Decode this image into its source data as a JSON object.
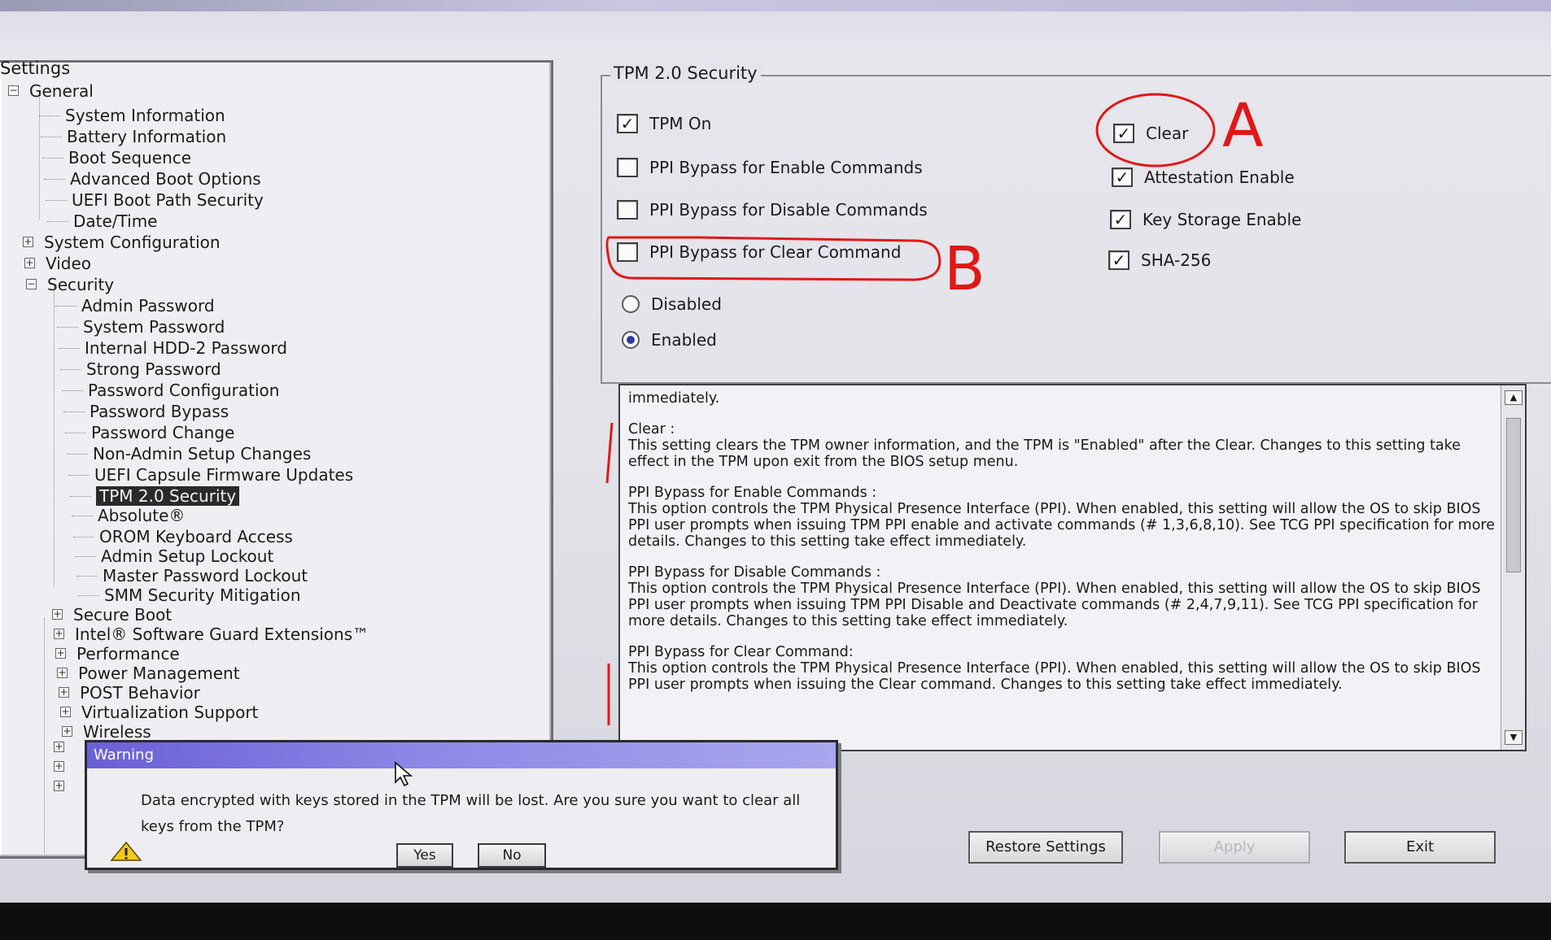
{
  "tree": {
    "title": "Settings",
    "items": [
      {
        "label": "General",
        "expander": "−"
      },
      {
        "label": "System Information"
      },
      {
        "label": "Battery Information"
      },
      {
        "label": "Boot Sequence"
      },
      {
        "label": "Advanced Boot Options"
      },
      {
        "label": "UEFI Boot Path Security"
      },
      {
        "label": "Date/Time"
      },
      {
        "label": "System Configuration",
        "expander": "+"
      },
      {
        "label": "Video",
        "expander": "+"
      },
      {
        "label": "Security",
        "expander": "−"
      },
      {
        "label": "Admin Password"
      },
      {
        "label": "System Password"
      },
      {
        "label": "Internal HDD-2 Password"
      },
      {
        "label": "Strong Password"
      },
      {
        "label": "Password Configuration"
      },
      {
        "label": "Password Bypass"
      },
      {
        "label": "Password Change"
      },
      {
        "label": "Non-Admin Setup Changes"
      },
      {
        "label": "UEFI Capsule Firmware Updates"
      },
      {
        "label": "TPM 2.0 Security",
        "selected": true
      },
      {
        "label": "Absolute®"
      },
      {
        "label": "OROM Keyboard Access"
      },
      {
        "label": "Admin Setup Lockout"
      },
      {
        "label": "Master Password Lockout"
      },
      {
        "label": "SMM Security Mitigation"
      },
      {
        "label": "Secure Boot",
        "expander": "+"
      },
      {
        "label": "Intel® Software Guard Extensions™",
        "expander": "+"
      },
      {
        "label": "Performance",
        "expander": "+"
      },
      {
        "label": "Power Management",
        "expander": "+"
      },
      {
        "label": "POST Behavior",
        "expander": "+"
      },
      {
        "label": "Virtualization Support",
        "expander": "+"
      },
      {
        "label": "Wireless",
        "expander": "+"
      }
    ]
  },
  "group": {
    "legend": "TPM 2.0 Security",
    "left_checks": [
      {
        "label": "TPM On",
        "checked": true
      },
      {
        "label": "PPI Bypass for Enable Commands",
        "checked": false
      },
      {
        "label": "PPI Bypass for Disable Commands",
        "checked": false
      },
      {
        "label": "PPI Bypass for Clear Command",
        "checked": false
      }
    ],
    "right_checks": [
      {
        "label": "Clear",
        "checked": true
      },
      {
        "label": "Attestation Enable",
        "checked": true
      },
      {
        "label": "Key Storage Enable",
        "checked": true
      },
      {
        "label": "SHA-256",
        "checked": true
      }
    ],
    "radios": [
      {
        "label": "Disabled",
        "selected": false
      },
      {
        "label": "Enabled",
        "selected": true
      }
    ],
    "check_mark": "☑"
  },
  "help": {
    "line0": "immediately.",
    "clear_title": "Clear :",
    "clear_text": "This setting clears the TPM owner information, and the TPM is \"Enabled\" after the Clear.  Changes to this setting take effect in the TPM upon exit from the BIOS setup menu.",
    "enable_title": "PPI Bypass for Enable Commands :",
    "enable_text": "This option controls the TPM Physical Presence Interface (PPI). When enabled, this setting will allow the OS to skip BIOS PPI user prompts when issuing TPM PPI enable and activate commands (# 1,3,6,8,10).  See TCG PPI specification for more details. Changes to this setting take effect immediately.",
    "disable_title": "PPI Bypass for Disable Commands :",
    "disable_text": "This option controls the TPM Physical Presence Interface (PPI). When enabled, this setting will allow the OS to skip BIOS PPI user prompts when issuing TPM PPI Disable and Deactivate commands (# 2,4,7,9,11).  See TCG PPI specification for more details.  Changes to this setting take effect immediately.",
    "clearcmd_title": "PPI Bypass for Clear Command:",
    "clearcmd_text": "This option controls the TPM Physical Presence Interface (PPI). When enabled, this setting will allow the OS to skip BIOS PPI user prompts when issuing the Clear command. Changes to this setting take effect immediately."
  },
  "buttons": {
    "restore": "Restore Settings",
    "apply": "Apply",
    "exit": "Exit"
  },
  "dialog": {
    "title": "Warning",
    "message": "Data encrypted with keys stored in the TPM will be lost. Are you sure you want to clear all keys from the TPM?",
    "yes": "Yes",
    "no": "No"
  },
  "annotations": {
    "a": "A",
    "b": "B",
    "color": "#e01818"
  }
}
